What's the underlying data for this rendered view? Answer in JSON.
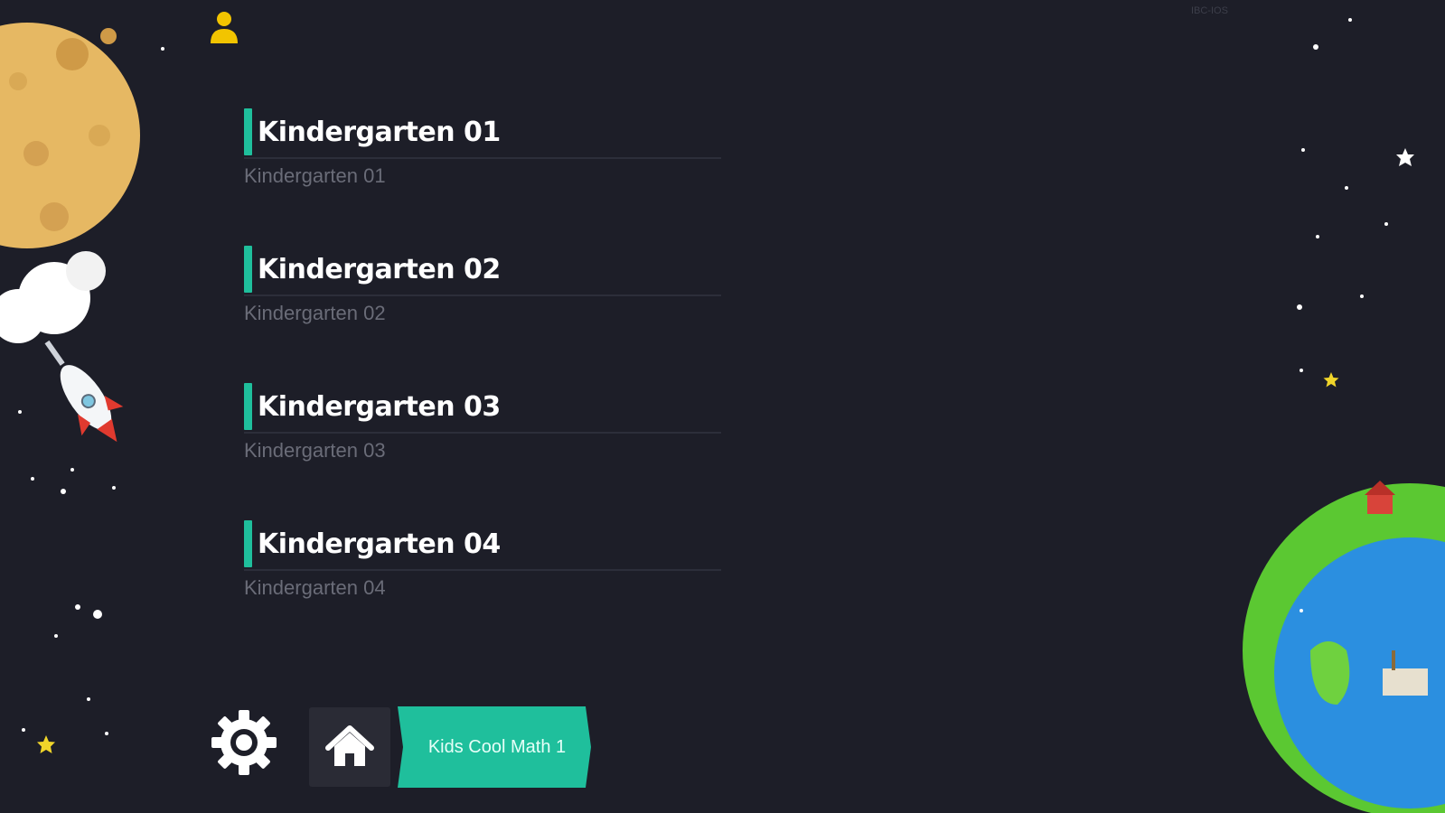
{
  "app": {
    "build_tag": "IBC-IOS"
  },
  "lessons": [
    {
      "title": "Kindergarten 01",
      "subtitle": "Kindergarten 01"
    },
    {
      "title": "Kindergarten 02",
      "subtitle": "Kindergarten 02"
    },
    {
      "title": "Kindergarten 03",
      "subtitle": "Kindergarten 03"
    },
    {
      "title": "Kindergarten 04",
      "subtitle": "Kindergarten 04"
    }
  ],
  "toolbar": {
    "course_label": "Kids Cool Math 1"
  },
  "colors": {
    "background": "#1d1e28",
    "accent": "#1fbf9c",
    "user_icon": "#f2c400"
  },
  "icons": {
    "user": "user-icon",
    "settings": "gear-icon",
    "home": "home-icon"
  }
}
